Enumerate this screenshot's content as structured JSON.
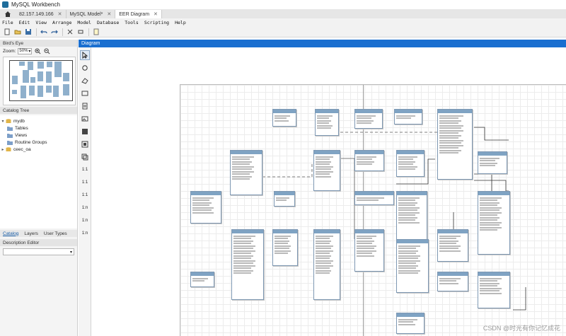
{
  "window": {
    "title": "MySQL Workbench"
  },
  "tabs": [
    {
      "label": "82.157.149.166"
    },
    {
      "label": "MySQL Model*"
    },
    {
      "label": "EER Diagram"
    }
  ],
  "menu": [
    "File",
    "Edit",
    "View",
    "Arrange",
    "Model",
    "Database",
    "Tools",
    "Scripting",
    "Help"
  ],
  "left_panel": {
    "birds_eye_title": "Bird's Eye",
    "zoom_label": "Zoom:",
    "zoom_value": "50%",
    "catalog_title": "Catalog Tree",
    "tree": [
      {
        "label": "mydb",
        "expanded": true,
        "level": 0
      },
      {
        "label": "Tables",
        "level": 1
      },
      {
        "label": "Views",
        "level": 1
      },
      {
        "label": "Routine Groups",
        "level": 1
      },
      {
        "label": "ceec_oa",
        "expanded": false,
        "level": 0
      }
    ],
    "panel_tabs": [
      "Catalog",
      "Layers",
      "User Types"
    ],
    "description_title": "Description Editor"
  },
  "vertical_tools": [
    "1:1",
    "1:1",
    "1:1",
    "1:n",
    "1:n",
    "1:n"
  ],
  "diagram": {
    "header": "Diagram"
  },
  "watermark": "CSDN @时光有你记忆成花",
  "colors": {
    "accent": "#1a6fd0",
    "table_header": "#7fa3c3"
  }
}
